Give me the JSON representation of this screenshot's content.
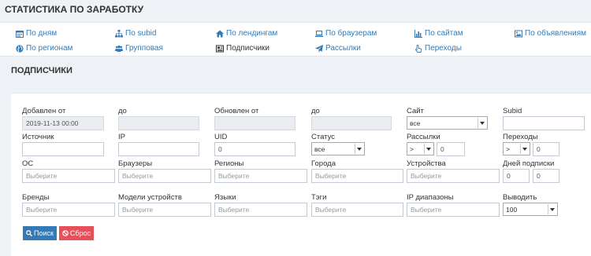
{
  "header": {
    "title": "Статистика по заработку"
  },
  "nav": {
    "items": [
      {
        "label": "По дням",
        "icon": "calendar-icon"
      },
      {
        "label": "По subid",
        "icon": "sitemap-icon"
      },
      {
        "label": "По лендингам",
        "icon": "home-icon"
      },
      {
        "label": "По браузерам",
        "icon": "laptop-icon"
      },
      {
        "label": "По сайтам",
        "icon": "bar-chart-icon"
      },
      {
        "label": "По объявлениям",
        "icon": "image-icon"
      },
      {
        "label": "По регионам",
        "icon": "globe-icon"
      },
      {
        "label": "Групповая",
        "icon": "users-icon"
      },
      {
        "label": "Подписчики",
        "icon": "newspaper-icon"
      },
      {
        "label": "Рассылки",
        "icon": "send-icon"
      },
      {
        "label": "Переходы",
        "icon": "pointer-icon"
      }
    ],
    "active": "Подписчики"
  },
  "section": {
    "title": "Подписчики"
  },
  "form": {
    "added_from": {
      "label": "Добавлен от",
      "value": "2019-11-13 00:00"
    },
    "added_to": {
      "label": "до",
      "value": ""
    },
    "updated_from": {
      "label": "Обновлен от",
      "value": ""
    },
    "updated_to": {
      "label": "до",
      "value": ""
    },
    "site": {
      "label": "Сайт",
      "value": "все"
    },
    "subid": {
      "label": "Subid",
      "value": ""
    },
    "source": {
      "label": "Источник",
      "value": ""
    },
    "ip": {
      "label": "IP",
      "value": ""
    },
    "uid": {
      "label": "UID",
      "value": "0"
    },
    "status": {
      "label": "Статус",
      "value": "все"
    },
    "mailings": {
      "label": "Рассылки",
      "operator": ">",
      "value": "0"
    },
    "clicks": {
      "label": "Переходы",
      "operator": ">",
      "value": "0"
    },
    "os": {
      "label": "ОС",
      "placeholder": "Выберите"
    },
    "browsers": {
      "label": "Браузеры",
      "placeholder": "Выберите"
    },
    "regions": {
      "label": "Регионы",
      "placeholder": "Выберите"
    },
    "cities": {
      "label": "Города",
      "placeholder": "Выберите"
    },
    "devices": {
      "label": "Устройства",
      "placeholder": "Выберите"
    },
    "sub_days": {
      "label": "Дней подписки",
      "from": "0",
      "to": "0"
    },
    "brands": {
      "label": "Бренды",
      "placeholder": "Выберите"
    },
    "device_models": {
      "label": "Модели устройств",
      "placeholder": "Выберите"
    },
    "languages": {
      "label": "Языки",
      "placeholder": "Выберите"
    },
    "tags": {
      "label": "Тэги",
      "placeholder": "Выберите"
    },
    "ip_ranges": {
      "label": "IP диапазоны",
      "placeholder": "Выберите"
    },
    "output": {
      "label": "Выводить",
      "value": "100"
    }
  },
  "buttons": {
    "search": "Поиск",
    "reset": "Сброс"
  },
  "colors": {
    "link": "#337ab7",
    "primary": "#337ab7",
    "danger": "#e7505a"
  }
}
